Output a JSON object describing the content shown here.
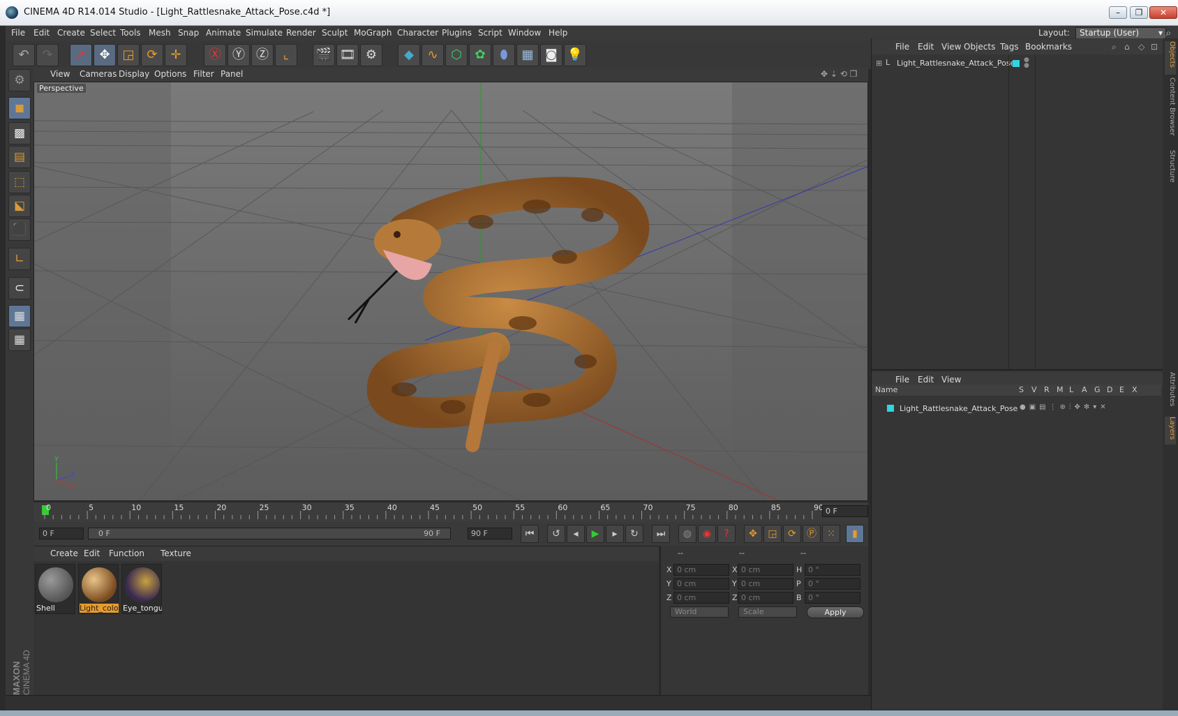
{
  "window": {
    "title": "CINEMA 4D R14.014 Studio - [Light_Rattlesnake_Attack_Pose.c4d *]"
  },
  "menubar": {
    "items": [
      "File",
      "Edit",
      "Create",
      "Select",
      "Tools",
      "Mesh",
      "Snap",
      "Animate",
      "Simulate",
      "Render",
      "Sculpt",
      "MoGraph",
      "Character",
      "Plugins",
      "Script",
      "Window",
      "Help"
    ],
    "layout_label": "Layout:",
    "layout_value": "Startup (User)"
  },
  "viewport": {
    "menu": [
      "View",
      "Cameras",
      "Display",
      "Options",
      "Filter",
      "Panel"
    ],
    "label": "Perspective",
    "axis": {
      "x": "X",
      "y": "Y",
      "z": "Z"
    }
  },
  "timeline": {
    "ticks": [
      "0",
      "5",
      "10",
      "15",
      "20",
      "25",
      "30",
      "35",
      "40",
      "45",
      "50",
      "55",
      "60",
      "65",
      "70",
      "75",
      "80",
      "85",
      "90"
    ],
    "current_frame": "0 F"
  },
  "transport": {
    "start": "0 F",
    "range_start": "0 F",
    "range_end": "90 F",
    "end": "90 F"
  },
  "materials": {
    "menu": [
      "Create",
      "Edit",
      "Function",
      "Texture"
    ],
    "items": [
      {
        "name": "Shell",
        "selected": false
      },
      {
        "name": "Light_color",
        "selected": true
      },
      {
        "name": "Eye_tongu",
        "selected": false
      }
    ]
  },
  "coords": {
    "header": [
      "--",
      "--",
      "--"
    ],
    "rows": [
      {
        "l1": "X",
        "v1": "0 cm",
        "l2": "X",
        "v2": "0 cm",
        "l3": "H",
        "v3": "0 °"
      },
      {
        "l1": "Y",
        "v1": "0 cm",
        "l2": "Y",
        "v2": "0 cm",
        "l3": "P",
        "v3": "0 °"
      },
      {
        "l1": "Z",
        "v1": "0 cm",
        "l2": "Z",
        "v2": "0 cm",
        "l3": "B",
        "v3": "0 °"
      }
    ],
    "mode": "World",
    "transform": "Scale",
    "apply": "Apply"
  },
  "objects": {
    "menu": [
      "File",
      "Edit",
      "View",
      "Objects",
      "Tags",
      "Bookmarks"
    ],
    "items": [
      "Light_Rattlesnake_Attack_Pose"
    ]
  },
  "layers": {
    "menu": [
      "File",
      "Edit",
      "View"
    ],
    "columns": [
      "Name",
      "S",
      "V",
      "R",
      "M",
      "L",
      "A",
      "G",
      "D",
      "E",
      "X"
    ],
    "items": [
      "Light_Rattlesnake_Attack_Pose"
    ]
  },
  "side_tabs": [
    "Objects",
    "Content Browser",
    "Structure",
    "Attributes",
    "Layers"
  ],
  "branding": {
    "maxon": "MAXON",
    "product": "CINEMA 4D"
  },
  "colors": {
    "accent": "#e89b2a",
    "layer": "#2fd6e0",
    "selection": "#5f7796"
  }
}
